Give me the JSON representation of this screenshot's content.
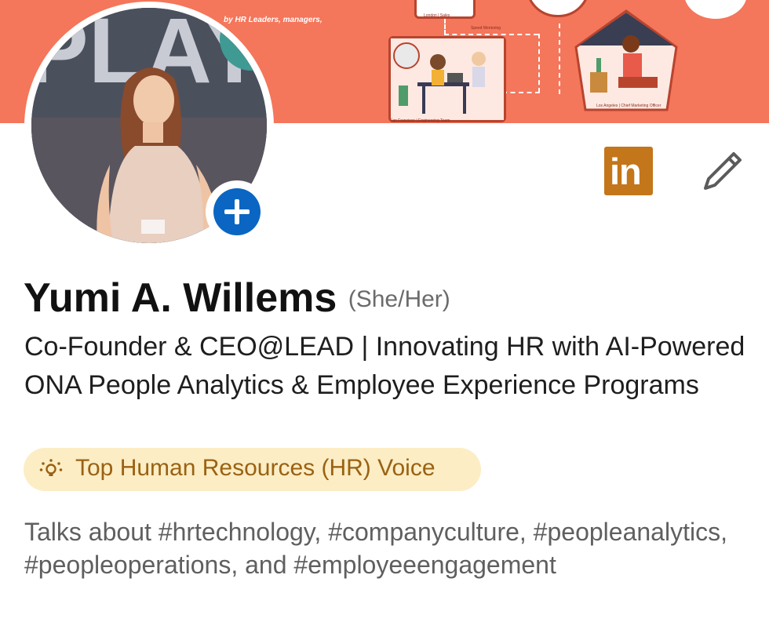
{
  "banner": {
    "caption": "by HR Leaders, managers,",
    "room_labels": [
      "London | Sales",
      "Speed Mentoring",
      "San Francisco | Engineering Team",
      "Los Angeles | Chief Marketing Officer"
    ]
  },
  "profile": {
    "name": "Yumi A. Willems",
    "pronouns": "(She/Her)",
    "headline": "Co-Founder & CEO@LEAD | Innovating HR with AI-Powered ONA People Analytics & Employee Experience Programs",
    "voice_badge": "Top Human Resources (HR) Voice",
    "talks_about": "Talks about #hrtechnology, #companyculture, #peopleanalytics, #peopleoperations, and #employeeengagement"
  },
  "actions": {
    "linkedin_icon_text": "in"
  },
  "colors": {
    "banner": "#f4765b",
    "linkedin": "#c4761a",
    "add_button": "#0a66c2",
    "badge_bg": "#fcedc5",
    "badge_text": "#9a6212"
  },
  "icons": [
    "plus-icon",
    "linkedin-icon",
    "pencil-icon",
    "lightbulb-icon"
  ]
}
